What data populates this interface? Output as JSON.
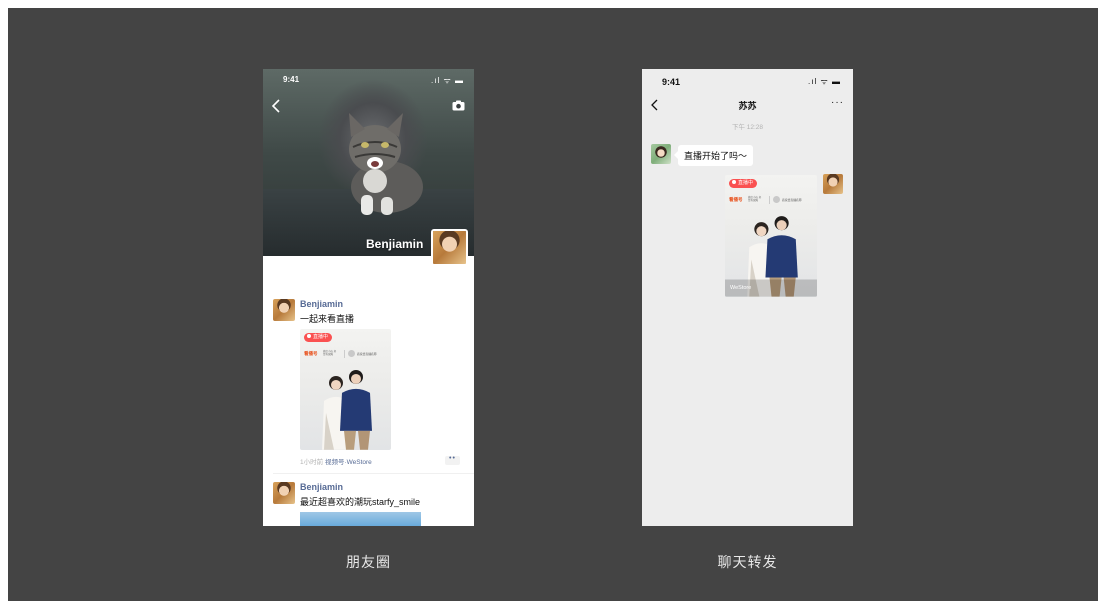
{
  "moments": {
    "status_time": "9:41",
    "status_icons": ".ıl ᯤ ▬",
    "profile_name": "Benjiamin",
    "posts": [
      {
        "author": "Benjiamin",
        "text": "一起来看直播",
        "live_badge": "直播中",
        "brand_logo": "看播号",
        "brand_sub": "微信小店 好货有保障",
        "brand_right": "商家给直播名称",
        "meta_time": "1小时前",
        "meta_source": "视频号·WeStore",
        "more": "••"
      },
      {
        "author": "Benjiamin",
        "text": "最近超喜欢的潮玩starfy_smile"
      }
    ]
  },
  "chat": {
    "status_time": "9:41",
    "status_icons": ".ıl ᯤ ▬",
    "title": "苏苏",
    "more": "···",
    "timestamp": "下午 12:28",
    "message": "直播开始了吗～",
    "card": {
      "live_badge": "直播中",
      "brand_logo": "看播号",
      "brand_sub": "微信小店 好货有保障",
      "brand_right": "商家给直播名称",
      "watermark": "WeStore"
    }
  },
  "captions": {
    "moments": "朋友圈",
    "chat": "聊天转发"
  },
  "colors": {
    "stage_background": "#444444",
    "link_blue": "#576b95",
    "live_red": "#fa5151",
    "chat_background": "#ededed"
  }
}
